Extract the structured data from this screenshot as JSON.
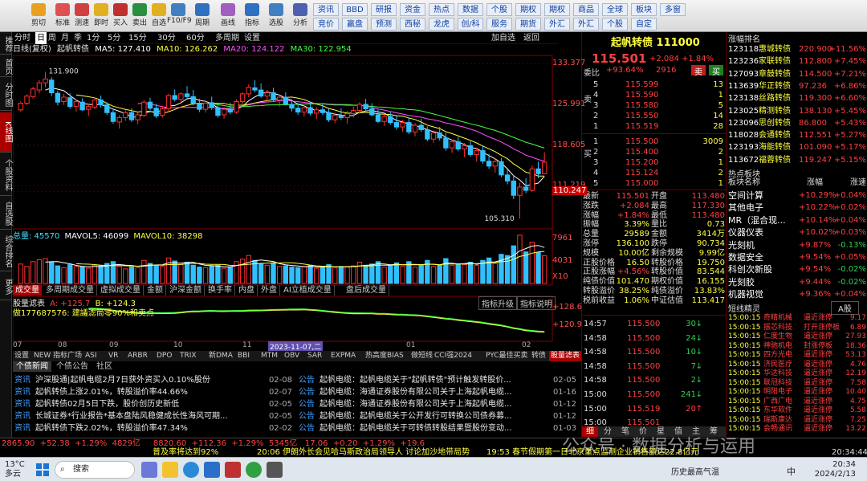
{
  "toolbar": {
    "items": [
      "剪切",
      "标准",
      "测速",
      "即时",
      "买入",
      "卖出",
      "自选",
      "F10/F9",
      "周期",
      "画线",
      "指标",
      "选股",
      "分析",
      "多窗口"
    ],
    "quick_btns": [
      "资讯",
      "竞价",
      "BBD",
      "赢盘",
      "研报",
      "预测",
      "资金",
      "西秘",
      "热点",
      "龙虎",
      "数据",
      "创/科",
      "个股",
      "服务",
      "期权",
      "期货",
      "期权",
      "外汇",
      "商品",
      "外汇",
      "全球",
      "个股",
      "板块",
      "自定",
      "多窗"
    ]
  },
  "left_nav": [
    "推荐",
    "首页",
    "分时图",
    "K线图",
    "个股资料",
    "自选股",
    "综合排名",
    "更多"
  ],
  "period_tabs": [
    "分时",
    "日",
    "周",
    "月",
    "季",
    "1分",
    "5分",
    "15分",
    "30分",
    "60分",
    "多周期",
    "设置"
  ],
  "period_right": [
    "加自选",
    "返回"
  ],
  "kline_info": {
    "name": "日线(复权)",
    "stock": "起帆转债",
    "ma5": "MA5: 127.410",
    "ma10": "MA10: 126.262",
    "ma20": "MA20: 124.122",
    "ma30": "MA30: 122.954"
  },
  "price_axis": [
    "133.377",
    "125.991",
    "118.605",
    "111.219",
    "110.247"
  ],
  "hi_label": "131.900",
  "lo_label": "105.310",
  "vol_info": {
    "total": "总量: 45570",
    "mavol5": "MAVOL5: 46099",
    "mavol10": "MAVOL10: 38298"
  },
  "vol_axis": [
    "7961",
    "4031",
    "X10"
  ],
  "sub_tabs": [
    "成交量",
    "多周期成交量",
    "虚拟成交量",
    "金额",
    "沪深金额",
    "换手率",
    "内盘",
    "外盘",
    "AI立植成交量",
    "盘后成交量"
  ],
  "ind_info": {
    "name": "股量滤表",
    "a": "A: +125.7",
    "b": "B: +124.3",
    "note": "做177687576: 建議滤筒零90%和卖点"
  },
  "ind_btns": [
    "指标升级",
    "指标说明"
  ],
  "ind_axis": [
    "+128.6",
    "+120.9"
  ],
  "date_axis": [
    "07",
    "08",
    "09",
    "10",
    "11",
    "12",
    "2023-11-07,二",
    "01",
    "02"
  ],
  "bottom_tabs": [
    "设置",
    "NEW 指标广场",
    "ASI",
    "VR",
    "ARBR",
    "DPO",
    "TRIX",
    "新DMA",
    "BBI",
    "MTM",
    "OBV",
    "SAR",
    "EXPMA",
    "热高度BIAS",
    "做短线",
    "CCI强2024",
    "PYC最佳买卖",
    "转债",
    "股量滤表"
  ],
  "news_tabs": [
    "个债新闻",
    "个债公告",
    "社区"
  ],
  "news_left": [
    {
      "tag": "资讯",
      "text": "沪深股通|起帆电缆2月7日获外资买入0.10%股份",
      "date": "02-08"
    },
    {
      "tag": "资讯",
      "text": "起帆转债上涨2.01%，转股溢价率44.66%",
      "date": "02-07"
    },
    {
      "tag": "资讯",
      "text": "起帆转债02月5日下跌，股价创历史新低",
      "date": "02-05"
    },
    {
      "tag": "资讯",
      "text": "长城证券*行业报告*基本盘陆风稳健成长性海风可期...",
      "date": "02-05"
    },
    {
      "tag": "资讯",
      "text": "起帆转债下跌2.02%，转股溢价率47.34%",
      "date": "02-02"
    }
  ],
  "news_right": [
    {
      "tag": "公告",
      "text": "起帆电缆：起帆电缆关于\"起帆转债\"预计触发转股价...",
      "date": "02-05"
    },
    {
      "tag": "公告",
      "text": "起帆电缆：海通证券股份有限公司关于上海起帆电缆...",
      "date": "01-16"
    },
    {
      "tag": "公告",
      "text": "起帆电缆：海通证券股份有限公司关于上海起帆电缆...",
      "date": "01-12"
    },
    {
      "tag": "公告",
      "text": "起帆电缆：起帆电缆关于公开发行可转换公司债券募...",
      "date": "01-12"
    },
    {
      "tag": "公告",
      "text": "起帆电缆：起帆电缆关于可转债转股结果暨股份变动...",
      "date": "01-03"
    }
  ],
  "quote": {
    "title": "起帆转债 111000",
    "price": "115.501",
    "chg": "+2.084",
    "pct": "+1.84%",
    "wb_label": "委比",
    "wb": "+93.64%",
    "wc": "2916",
    "sell_btn": "卖",
    "buy_btn": "买"
  },
  "asks": [
    {
      "l": "5",
      "p": "115.599",
      "v": "13"
    },
    {
      "l": "4",
      "p": "115.590",
      "v": "1"
    },
    {
      "l": "3",
      "p": "115.580",
      "v": "5"
    },
    {
      "l": "2",
      "p": "115.550",
      "v": "14"
    },
    {
      "l": "1",
      "p": "115.519",
      "v": "28"
    }
  ],
  "bids": [
    {
      "l": "1",
      "p": "115.500",
      "v": "3009"
    },
    {
      "l": "2",
      "p": "115.400",
      "v": "2"
    },
    {
      "l": "3",
      "p": "115.200",
      "v": "1"
    },
    {
      "l": "4",
      "p": "115.124",
      "v": "2"
    },
    {
      "l": "5",
      "p": "115.000",
      "v": "1"
    }
  ],
  "ask_side": "卖",
  "bid_side": "买",
  "stats": [
    [
      "最新",
      "115.501",
      "开盘",
      "113.480"
    ],
    [
      "涨跌",
      "+2.084",
      "最高",
      "117.330"
    ],
    [
      "涨幅",
      "+1.84%",
      "最低",
      "113.480"
    ],
    [
      "振幅",
      "3.39%",
      "量比",
      "0.73"
    ],
    [
      "总量",
      "29589",
      "金额",
      "3414万"
    ],
    [
      "涨停",
      "136.100",
      "跌停",
      "90.734"
    ],
    [
      "规模",
      "10.00亿",
      "剩余规模",
      "9.99亿"
    ],
    [
      "正股价格",
      "16.50",
      "转股价格",
      "19.750"
    ],
    [
      "正股涨幅",
      "+4.56%",
      "转股价值",
      "83.544"
    ],
    [
      "纯债价值",
      "101.470",
      "期权价值",
      "16.155"
    ],
    [
      "转股溢价",
      "38.25%",
      "纯债溢价",
      "13.83%"
    ],
    [
      "税前收益",
      "1.06%",
      "中证估值",
      "113.417"
    ]
  ],
  "ticks": [
    {
      "t": "14:57",
      "p": "115.500",
      "v": "30",
      "d": "B"
    },
    {
      "t": "14:58",
      "p": "115.500",
      "v": "24",
      "d": "B"
    },
    {
      "t": "14:58",
      "p": "115.500",
      "v": "10",
      "d": "B"
    },
    {
      "t": "14:58",
      "p": "115.500",
      "v": "7",
      "d": "B"
    },
    {
      "t": "14:58",
      "p": "115.500",
      "v": "2",
      "d": "B"
    },
    {
      "t": "15:00",
      "p": "115.500",
      "v": "241",
      "d": "B"
    },
    {
      "t": "15:00",
      "p": "115.519",
      "v": "20",
      "d": "S"
    },
    {
      "t": "15:00",
      "p": "115.501",
      "v": "",
      "d": ""
    }
  ],
  "right_tabs": [
    "细",
    "分",
    "笔",
    "价",
    "星",
    "值",
    "主",
    "筹"
  ],
  "rank_title": "涨幅排名",
  "rank": [
    {
      "code": "123118",
      "name": "惠城转债",
      "p": "220.900",
      "pct": "+11.56%"
    },
    {
      "code": "123236",
      "name": "家联转债",
      "p": "112.800",
      "pct": "+7.45%"
    },
    {
      "code": "127093",
      "name": "章鼓转债",
      "p": "114.500",
      "pct": "+7.21%"
    },
    {
      "code": "113639",
      "name": "华正转债",
      "p": "97.236",
      "pct": "+6.86%"
    },
    {
      "code": "123138",
      "name": "丝路转债",
      "p": "119.300",
      "pct": "+6.60%"
    },
    {
      "code": "123025",
      "name": "精测转债",
      "p": "138.130",
      "pct": "+5.45%"
    },
    {
      "code": "123096",
      "name": "思创转债",
      "p": "86.800",
      "pct": "+5.43%"
    },
    {
      "code": "118028",
      "name": "会通转债",
      "p": "112.551",
      "pct": "+5.27%"
    },
    {
      "code": "123193",
      "name": "海能转债",
      "p": "101.090",
      "pct": "+5.17%"
    },
    {
      "code": "113672",
      "name": "福蓉转债",
      "p": "119.247",
      "pct": "+5.15%"
    }
  ],
  "sector_title": "热点板块",
  "sector_head": [
    "板块名称",
    "涨幅",
    "涨速"
  ],
  "sectors": [
    {
      "n": "空间计算",
      "a": "+10.29%",
      "b": "+0.04%"
    },
    {
      "n": "其他电子",
      "a": "+10.22%",
      "b": "+0.02%"
    },
    {
      "n": "MR（混合现...",
      "a": "+10.14%",
      "b": "+0.04%"
    },
    {
      "n": "仪器仪表",
      "a": "+10.02%",
      "b": "+0.03%"
    },
    {
      "n": "光刻机",
      "a": "+9.87%",
      "b": "-0.13%"
    },
    {
      "n": "数据安全",
      "a": "+9.54%",
      "b": "+0.05%"
    },
    {
      "n": "科创次新股",
      "a": "+9.54%",
      "b": "-0.02%"
    },
    {
      "n": "光刻胶",
      "a": "+9.44%",
      "b": "-0.02%"
    },
    {
      "n": "机器视觉",
      "a": "+9.36%",
      "b": "+0.04%"
    }
  ],
  "short_title": "短线精灵",
  "short_sel": "A股",
  "short": [
    {
      "t": "15:00:15",
      "n": "奇精机械",
      "e": "逼近涨停",
      "v": "9.17"
    },
    {
      "t": "15:00:15",
      "n": "振芯科技",
      "e": "打开涨停板",
      "v": "6.89"
    },
    {
      "t": "15:00:15",
      "n": "仁度生物",
      "e": "逼近涨停",
      "v": "27.93"
    },
    {
      "t": "15:00:15",
      "n": "神驰机电",
      "e": "封涨停板",
      "v": "18.36"
    },
    {
      "t": "15:00:15",
      "n": "四方光电",
      "e": "逼近涨停",
      "v": "53.13"
    },
    {
      "t": "15:00:15",
      "n": "济民医疗",
      "e": "逼近涨停",
      "v": "4.76"
    },
    {
      "t": "15:00:15",
      "n": "华达科技",
      "e": "逼近涨停",
      "v": "12.19"
    },
    {
      "t": "15:00:15",
      "n": "联冠科技",
      "e": "逼近涨停",
      "v": "7.58"
    },
    {
      "t": "15:00:15",
      "n": "明阳电子",
      "e": "逼近涨停",
      "v": "10.40"
    },
    {
      "t": "15:00:15",
      "n": "广西广电",
      "e": "逼近涨停",
      "v": "4.75"
    },
    {
      "t": "15:00:15",
      "n": "东华软件",
      "e": "逼近涨停",
      "v": "5.58"
    },
    {
      "t": "15:00:15",
      "n": "瑞斯康达",
      "e": "逼近涨停",
      "v": "7.25"
    },
    {
      "t": "15:00:15",
      "n": "会畅通讯",
      "e": "逼近涨停",
      "v": "13.22"
    }
  ],
  "ticker": {
    "l1": "2865.90  +52.38  +1.29%  4829亿     8820.60  +112.36  +1.29%  5345亿   17.06  +0.20  +1.29%  +19.6",
    "l2a": "普及率将达到92%",
    "l2b": "20:06 伊朗外长会见哈马斯政治局领导人 讨论加沙地带局势",
    "l2c": "19:53 春节假期第一日北京重点监测企业销售额达22.8亿元",
    "time": "20:34:44"
  },
  "taskbar": {
    "weather": "13°C",
    "weather_desc": "多云",
    "search": "搜索",
    "app": "历史最高气温",
    "lang": "中",
    "time": "20:34",
    "date": "2024/2/13"
  },
  "watermark": "公众号 · 数据分析与运用",
  "candles": [
    [
      125.0,
      126.5,
      124.6,
      126.2
    ],
    [
      126.2,
      127.8,
      125.9,
      127.5
    ],
    [
      127.4,
      129.2,
      127.0,
      128.8
    ],
    [
      128.6,
      130.4,
      128.0,
      129.9
    ],
    [
      129.9,
      131.9,
      129.1,
      130.6
    ],
    [
      130.4,
      130.9,
      127.5,
      128.1
    ],
    [
      128.0,
      128.5,
      125.8,
      126.4
    ],
    [
      126.5,
      127.9,
      125.9,
      127.3
    ],
    [
      127.2,
      128.0,
      125.2,
      125.6
    ],
    [
      125.6,
      126.8,
      124.7,
      126.5
    ],
    [
      126.4,
      127.1,
      124.8,
      125.0
    ],
    [
      125.1,
      126.0,
      123.9,
      125.6
    ],
    [
      125.5,
      127.2,
      125.1,
      126.8
    ],
    [
      126.8,
      127.6,
      125.4,
      125.9
    ],
    [
      125.9,
      126.4,
      124.1,
      124.5
    ],
    [
      124.5,
      125.2,
      122.5,
      122.9
    ],
    [
      122.8,
      124.0,
      121.6,
      123.6
    ],
    [
      123.6,
      124.9,
      123.0,
      124.5
    ],
    [
      124.5,
      125.3,
      122.8,
      123.2
    ],
    [
      123.2,
      124.6,
      122.4,
      124.1
    ],
    [
      124.0,
      126.8,
      123.7,
      126.4
    ],
    [
      126.4,
      127.2,
      124.9,
      125.3
    ],
    [
      125.3,
      126.1,
      123.5,
      123.9
    ],
    [
      124.0,
      125.7,
      123.6,
      125.2
    ],
    [
      125.2,
      127.9,
      124.8,
      127.6
    ],
    [
      127.6,
      128.7,
      126.5,
      126.9
    ],
    [
      126.9,
      128.2,
      126.3,
      127.9
    ],
    [
      127.9,
      129.3,
      127.0,
      127.4
    ],
    [
      127.4,
      128.6,
      125.8,
      126.2
    ],
    [
      126.1,
      127.0,
      124.6,
      125.1
    ],
    [
      125.1,
      126.6,
      124.5,
      126.2
    ],
    [
      126.3,
      127.4,
      125.0,
      125.4
    ],
    [
      125.4,
      126.0,
      123.6,
      124.0
    ],
    [
      124.1,
      125.5,
      123.4,
      125.1
    ],
    [
      125.1,
      126.3,
      124.2,
      124.6
    ],
    [
      124.6,
      126.9,
      124.3,
      126.5
    ],
    [
      126.5,
      128.2,
      126.1,
      127.9
    ],
    [
      127.9,
      129.6,
      127.3,
      129.1
    ],
    [
      129.0,
      130.4,
      128.2,
      128.6
    ],
    [
      128.6,
      129.8,
      127.2,
      127.5
    ],
    [
      127.5,
      128.6,
      126.4,
      128.1
    ],
    [
      128.1,
      129.0,
      126.5,
      126.8
    ],
    [
      126.8,
      127.8,
      125.6,
      127.3
    ],
    [
      127.3,
      128.2,
      125.8,
      126.0
    ],
    [
      126.0,
      126.9,
      124.7,
      125.3
    ],
    [
      125.3,
      126.3,
      124.1,
      124.6
    ],
    [
      124.6,
      125.9,
      123.8,
      125.4
    ],
    [
      125.4,
      126.5,
      124.0,
      124.4
    ],
    [
      124.4,
      125.5,
      123.3,
      125.0
    ],
    [
      125.0,
      126.1,
      124.1,
      124.5
    ],
    [
      124.5,
      125.2,
      122.8,
      123.2
    ],
    [
      123.2,
      124.5,
      122.6,
      124.0
    ],
    [
      124.0,
      125.3,
      123.2,
      123.6
    ],
    [
      123.6,
      124.8,
      122.5,
      124.3
    ],
    [
      124.3,
      125.6,
      123.6,
      124.9
    ],
    [
      124.9,
      126.4,
      124.3,
      126.0
    ],
    [
      126.0,
      127.0,
      124.9,
      125.2
    ],
    [
      125.2,
      126.2,
      123.8,
      124.1
    ],
    [
      124.1,
      125.0,
      122.6,
      122.9
    ],
    [
      122.9,
      124.2,
      122.1,
      123.8
    ],
    [
      123.8,
      124.6,
      122.3,
      122.7
    ],
    [
      122.7,
      123.9,
      121.4,
      121.9
    ],
    [
      121.9,
      123.2,
      121.0,
      122.7
    ],
    [
      122.7,
      123.5,
      120.6,
      121.0
    ],
    [
      121.0,
      122.6,
      120.2,
      122.2
    ],
    [
      122.2,
      123.4,
      121.0,
      121.4
    ],
    [
      121.4,
      122.0,
      119.3,
      119.7
    ],
    [
      119.7,
      121.3,
      119.0,
      120.8
    ],
    [
      120.8,
      121.9,
      119.4,
      119.9
    ],
    [
      119.9,
      120.8,
      117.6,
      118.1
    ],
    [
      118.1,
      119.6,
      117.2,
      119.2
    ],
    [
      119.2,
      120.1,
      117.5,
      117.9
    ],
    [
      117.9,
      119.0,
      116.4,
      118.5
    ],
    [
      118.5,
      119.3,
      116.5,
      116.9
    ],
    [
      116.9,
      118.1,
      115.6,
      117.6
    ],
    [
      117.6,
      118.4,
      115.2,
      115.7
    ],
    [
      115.7,
      117.0,
      114.3,
      114.8
    ],
    [
      114.8,
      116.2,
      113.6,
      115.6
    ],
    [
      115.6,
      116.3,
      112.8,
      113.2
    ],
    [
      113.2,
      114.5,
      111.5,
      112.1
    ],
    [
      112.1,
      113.2,
      108.8,
      109.5
    ],
    [
      109.5,
      111.8,
      105.3,
      111.0
    ],
    [
      111.0,
      112.6,
      109.9,
      110.4
    ],
    [
      110.4,
      114.9,
      110.1,
      114.3
    ],
    [
      114.3,
      115.6,
      112.6,
      113.4
    ],
    [
      113.4,
      117.3,
      113.4,
      115.5
    ]
  ],
  "volumes": [
    3200,
    2800,
    3600,
    3900,
    4100,
    3500,
    2900,
    2600,
    3100,
    2800,
    2700,
    2500,
    3000,
    2900,
    3300,
    3600,
    2800,
    2400,
    2700,
    2600,
    3800,
    3300,
    2900,
    2800,
    4200,
    3700,
    3100,
    3500,
    3000,
    2700,
    2600,
    2900,
    3000,
    2500,
    2700,
    3600,
    4000,
    4600,
    3800,
    3300,
    3000,
    3400,
    2800,
    2900,
    2700,
    2600,
    2800,
    3000,
    2500,
    2700,
    3100,
    2600,
    2800,
    2700,
    2900,
    3500,
    3000,
    3200,
    3600,
    2700,
    2900,
    3400,
    2800,
    3600,
    2700,
    3000,
    3800,
    2800,
    3000,
    4100,
    3000,
    3200,
    3100,
    3500,
    3000,
    3800,
    4200,
    3300,
    4800,
    4600,
    6200,
    7961,
    5200,
    6800,
    5100,
    4557
  ]
}
